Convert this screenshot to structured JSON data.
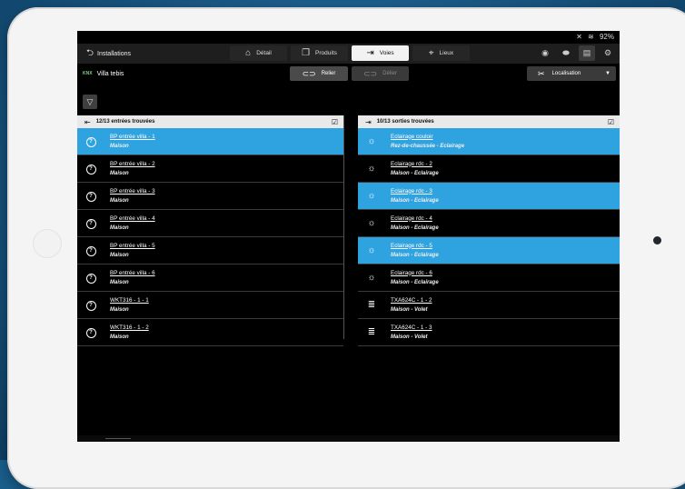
{
  "status": {
    "signal": "✕",
    "wifi": "≋",
    "battery": "92%"
  },
  "nav": {
    "back_label": "Installations",
    "tabs": [
      {
        "label": "Détail",
        "icon": "home-icon"
      },
      {
        "label": "Produits",
        "icon": "cube-icon"
      },
      {
        "label": "Voies",
        "icon": "channel-icon"
      },
      {
        "label": "Lieux",
        "icon": "location-pin-icon"
      }
    ],
    "active_tab": "Voies"
  },
  "project": {
    "logo": "KNX",
    "name": "Villa tebis"
  },
  "actions": {
    "relier": "Relier",
    "delier": "Délier",
    "localisation": "Localisation"
  },
  "inputs_panel": {
    "header": "12/13 entrées trouvées",
    "items": [
      {
        "name": "BP entrée villa - 1",
        "place": "Maison",
        "selected": true
      },
      {
        "name": "BP entrée villa - 2",
        "place": "Maison",
        "selected": false
      },
      {
        "name": "BP entrée villa - 3",
        "place": "Maison",
        "selected": false
      },
      {
        "name": "BP entrée villa - 4",
        "place": "Maison",
        "selected": false
      },
      {
        "name": "BP entrée villa - 5",
        "place": "Maison",
        "selected": false
      },
      {
        "name": "BP entrée villa - 6",
        "place": "Maison",
        "selected": false
      },
      {
        "name": "WKT316 - 1 - 1",
        "place": "Maison",
        "selected": false
      },
      {
        "name": "WKT316 - 1 - 2",
        "place": "Maison",
        "selected": false
      }
    ]
  },
  "outputs_panel": {
    "header": "10/13 sorties trouvées",
    "items": [
      {
        "name": "Eclairage couloir",
        "place": "Rez-de-chaussée - Eclairage",
        "icon": "light-icon",
        "selected": true
      },
      {
        "name": "Eclairage rdc - 2",
        "place": "Maison - Eclairage",
        "icon": "light-icon",
        "selected": false
      },
      {
        "name": "Eclairage rdc - 3",
        "place": "Maison - Eclairage",
        "icon": "light-icon",
        "selected": true
      },
      {
        "name": "Eclairage rdc - 4",
        "place": "Maison - Eclairage",
        "icon": "light-icon",
        "selected": false
      },
      {
        "name": "Eclairage rdc - 5",
        "place": "Maison - Eclairage",
        "icon": "light-icon",
        "selected": true
      },
      {
        "name": "Eclairage rdc - 6",
        "place": "Maison - Eclairage",
        "icon": "light-icon",
        "selected": false
      },
      {
        "name": "TXA624C - 1 - 2",
        "place": "Maison - Volet",
        "icon": "shutter-icon",
        "selected": false
      },
      {
        "name": "TXA624C - 1 - 3",
        "place": "Maison - Volet",
        "icon": "shutter-icon",
        "selected": false
      }
    ]
  },
  "colors": {
    "selected": "#2ea3e0",
    "background": "#000000",
    "header": "#e9e9e9"
  }
}
